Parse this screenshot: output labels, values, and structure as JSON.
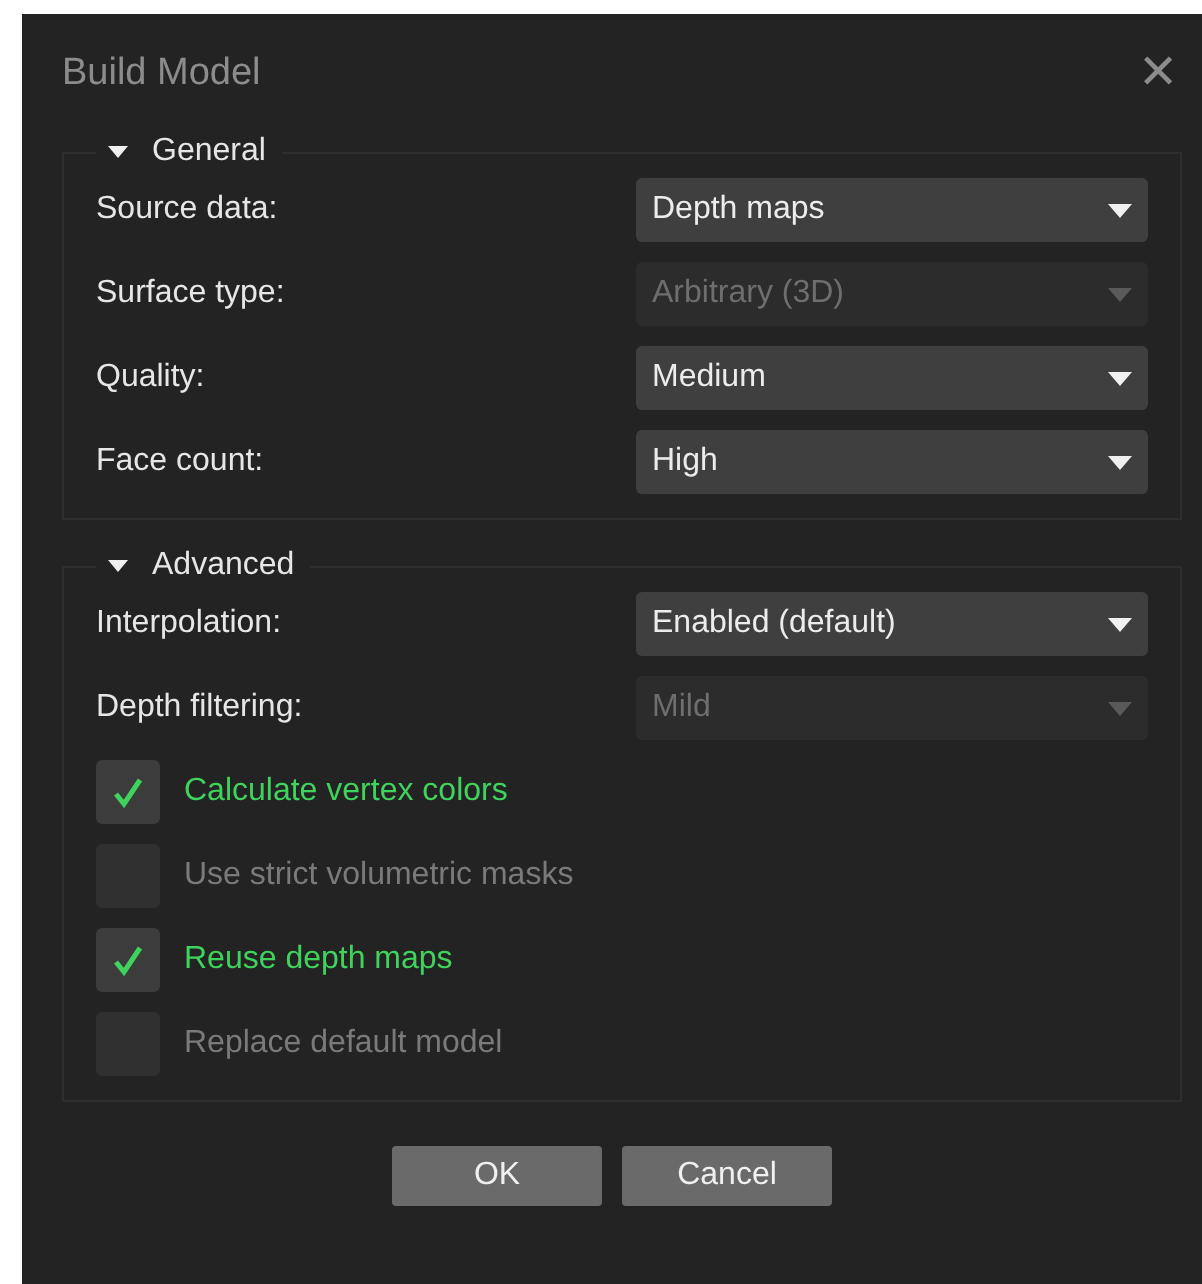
{
  "window": {
    "title": "Build Model",
    "close": "✕"
  },
  "sections": [
    {
      "title": "General",
      "expanded": true,
      "fields": [
        {
          "kind": "combo",
          "label": "Source data:",
          "value": "Depth maps",
          "disabled": false
        },
        {
          "kind": "combo",
          "label": "Surface type:",
          "value": "Arbitrary (3D)",
          "disabled": true
        },
        {
          "kind": "combo",
          "label": "Quality:",
          "value": "Medium",
          "disabled": false
        },
        {
          "kind": "combo",
          "label": "Face count:",
          "value": "High",
          "disabled": false
        }
      ]
    },
    {
      "title": "Advanced",
      "expanded": true,
      "fields": [
        {
          "kind": "combo",
          "label": "Interpolation:",
          "value": "Enabled (default)",
          "disabled": false
        },
        {
          "kind": "combo",
          "label": "Depth filtering:",
          "value": "Mild",
          "disabled": true
        },
        {
          "kind": "checkbox",
          "label": "Calculate vertex colors",
          "checked": true,
          "disabled": false
        },
        {
          "kind": "checkbox",
          "label": "Use strict volumetric masks",
          "checked": false,
          "disabled": true
        },
        {
          "kind": "checkbox",
          "label": "Reuse depth maps",
          "checked": true,
          "disabled": false
        },
        {
          "kind": "checkbox",
          "label": "Replace default model",
          "checked": false,
          "disabled": true
        }
      ]
    }
  ],
  "buttons": [
    "OK",
    "Cancel"
  ]
}
